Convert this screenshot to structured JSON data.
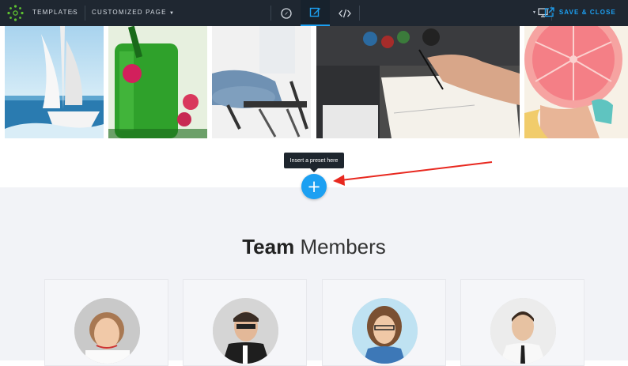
{
  "topbar": {
    "templates_label": "TEMPLATES",
    "separator_chevron": "›",
    "page_label": "CUSTOMIZED PAGE",
    "save_label": "SAVE & CLOSE",
    "accent_color": "#1ca0f2"
  },
  "gallery": {
    "images": [
      {
        "name": "sailboat-image"
      },
      {
        "name": "smoothie-image"
      },
      {
        "name": "office-chair-image"
      },
      {
        "name": "designer-sketching-image"
      },
      {
        "name": "grapefruit-image"
      }
    ]
  },
  "preset": {
    "tooltip": "Insert a preset here",
    "button_label": "+"
  },
  "team": {
    "title_bold": "Team",
    "title_light": "Members",
    "members": [
      {
        "avatar": "smiling-woman-avatar"
      },
      {
        "avatar": "man-on-phone-avatar"
      },
      {
        "avatar": "woman-with-glasses-avatar"
      },
      {
        "avatar": "man-in-shirt-avatar"
      }
    ]
  }
}
